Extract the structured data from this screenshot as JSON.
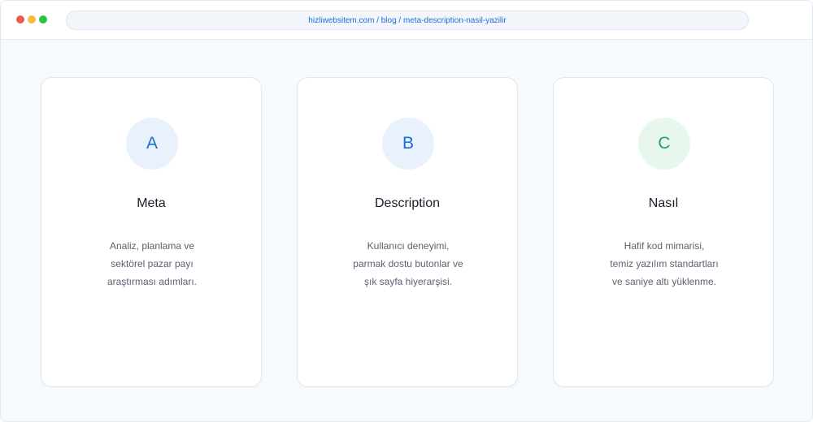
{
  "browser": {
    "url": "hizliwebsitem.com / blog / meta-description-nasil-yazilir"
  },
  "colors": {
    "accent_blue": "#1a6fd7",
    "accent_green": "#1fa65d",
    "window_close": "#ed5b55",
    "window_minimize": "#f4bd3c",
    "window_maximize": "#31c048"
  },
  "cards": [
    {
      "badge": "A",
      "title": "Meta",
      "lines": [
        "Analiz, planlama ve",
        "sektörel pazar payı",
        "araştırması adımları."
      ]
    },
    {
      "badge": "B",
      "title": "Description",
      "lines": [
        "Kullanıcı deneyimi,",
        "parmak dostu butonlar ve",
        "şık sayfa hiyerarşisi."
      ]
    },
    {
      "badge": "C",
      "title": "Nasıl",
      "lines": [
        "Hafif kod mimarisi,",
        "temiz yazılım standartları",
        "ve saniye altı yüklenme."
      ]
    }
  ]
}
